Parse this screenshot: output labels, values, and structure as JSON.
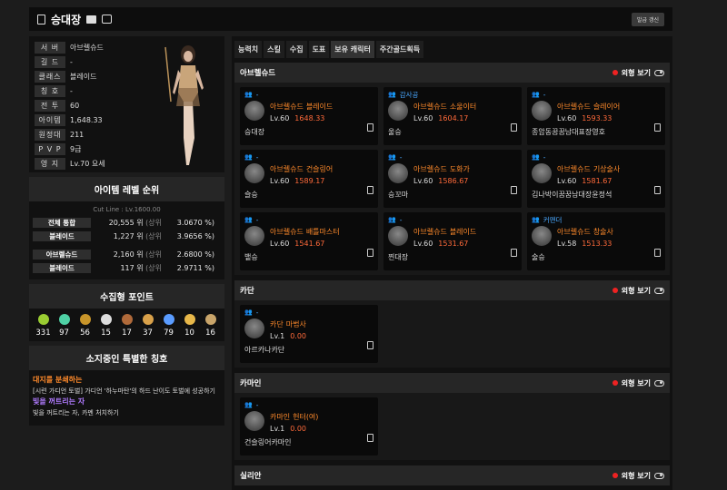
{
  "header": {
    "title": "승대장",
    "refresh_label": "발급 갱신"
  },
  "profile": {
    "rows": [
      {
        "label": "서 버",
        "value": "아브렐슈드"
      },
      {
        "label": "길 드",
        "value": "-"
      },
      {
        "label": "클래스",
        "value": "블레이드"
      },
      {
        "label": "칭 호",
        "value": "-"
      },
      {
        "label": "전 투",
        "value": "60"
      },
      {
        "label": "아이템",
        "value": "1,648.33"
      },
      {
        "label": "원정대",
        "value": "211"
      },
      {
        "label": "P V P",
        "value": "9급"
      },
      {
        "label": "영 지",
        "value": "Lv.70 요세"
      }
    ]
  },
  "ranking": {
    "title": "아이템 레벨 순위",
    "cutline": "Cut Line : Lv.1600.00",
    "group1": [
      {
        "label": "전체 통합",
        "rank": "20,555 위",
        "sub": "(상위",
        "pct": "3.0670 %)"
      },
      {
        "label": "블레이드",
        "rank": "1,227 위",
        "sub": "(상위",
        "pct": "3.9656 %)"
      }
    ],
    "group2": [
      {
        "label": "아브렐슈드",
        "rank": "2,160 위",
        "sub": "(상위",
        "pct": "2.6800 %)"
      },
      {
        "label": "블레이드",
        "rank": "117 위",
        "sub": "(상위",
        "pct": "2.9711 %)"
      }
    ]
  },
  "collection": {
    "title": "수집형 포인트",
    "items": [
      {
        "icon": "mokoko-seed-icon",
        "color": "#9acd32",
        "value": "331"
      },
      {
        "icon": "island-soul-icon",
        "color": "#4fd1a5",
        "value": "97"
      },
      {
        "icon": "giant-heart-icon",
        "color": "#c8952a",
        "value": "56"
      },
      {
        "icon": "ignea-token-icon",
        "color": "#dddddd",
        "value": "15"
      },
      {
        "icon": "art-icon",
        "color": "#b06a3a",
        "value": "17"
      },
      {
        "icon": "voyage-icon",
        "color": "#d9a14a",
        "value": "37"
      },
      {
        "icon": "world-tree-leaf-icon",
        "color": "#5a9cff",
        "value": "79"
      },
      {
        "icon": "orpheus-star-icon",
        "color": "#e8b84a",
        "value": "10"
      },
      {
        "icon": "medal-icon",
        "color": "#c9a56a",
        "value": "16"
      }
    ]
  },
  "titles": {
    "title": "소지중인 특별한 칭호",
    "items": [
      {
        "name": "대지를 분쇄하는",
        "desc": "[시련 가디언 토벌] 가디언 '하누마탄'의 하드 난이도 토벌에 성공하기",
        "color": "#ff8a2b"
      },
      {
        "name": "빛을 꺼트리는 자",
        "desc": "빛을 꺼트리는 자, 카멘 처치하기",
        "color": "#b07bff"
      }
    ]
  },
  "tabs": [
    "능력치",
    "스킬",
    "수집",
    "도표",
    "보유 캐릭터",
    "주간골드획득"
  ],
  "active_tab": "보유 캐릭터",
  "servers": [
    {
      "name": "아브렐슈드",
      "view_label": "외형 보기",
      "characters": [
        {
          "guild": "-",
          "server": "아브렐슈드",
          "class": "블레이드",
          "level": "Lv.60",
          "item_level": "1648.33",
          "name": "승대장"
        },
        {
          "guild": "감사공",
          "server": "아브렐슈드",
          "class": "소울이터",
          "level": "Lv.60",
          "item_level": "1604.17",
          "name": "울승"
        },
        {
          "guild": "-",
          "server": "아브렐슈드",
          "class": "슬레이어",
          "level": "Lv.60",
          "item_level": "1593.33",
          "name": "종암동꿈꿈남대표장영호"
        },
        {
          "guild": "-",
          "server": "아브렐슈드",
          "class": "건슬링어",
          "level": "Lv.60",
          "item_level": "1589.17",
          "name": "슬승"
        },
        {
          "guild": "-",
          "server": "아브렐슈드",
          "class": "도화가",
          "level": "Lv.60",
          "item_level": "1586.67",
          "name": "승꼬마"
        },
        {
          "guild": "-",
          "server": "아브렐슈드",
          "class": "기상술사",
          "level": "Lv.60",
          "item_level": "1581.67",
          "name": "김나박이꿈꿈남대장윤정석"
        },
        {
          "guild": "-",
          "server": "아브렐슈드",
          "class": "배틀마스터",
          "level": "Lv.60",
          "item_level": "1541.67",
          "name": "뱉승"
        },
        {
          "guild": "-",
          "server": "아브렐슈드",
          "class": "블레이드",
          "level": "Lv.60",
          "item_level": "1531.67",
          "name": "찐대장"
        },
        {
          "guild": "커맨더",
          "server": "아브렐슈드",
          "class": "창술사",
          "level": "Lv.58",
          "item_level": "1513.33",
          "name": "술승"
        }
      ]
    },
    {
      "name": "카단",
      "view_label": "외형 보기",
      "characters": [
        {
          "guild": "-",
          "server": "카단",
          "class": "마법사",
          "level": "Lv.1",
          "item_level": "0.00",
          "name": "아르카나카단"
        }
      ]
    },
    {
      "name": "카마인",
      "view_label": "외형 보기",
      "characters": [
        {
          "guild": "-",
          "server": "카마인",
          "class": "헌터(여)",
          "level": "Lv.1",
          "item_level": "0.00",
          "name": "건슬링어카마인"
        }
      ]
    },
    {
      "name": "실리안",
      "view_label": "외형 보기",
      "characters": []
    }
  ]
}
